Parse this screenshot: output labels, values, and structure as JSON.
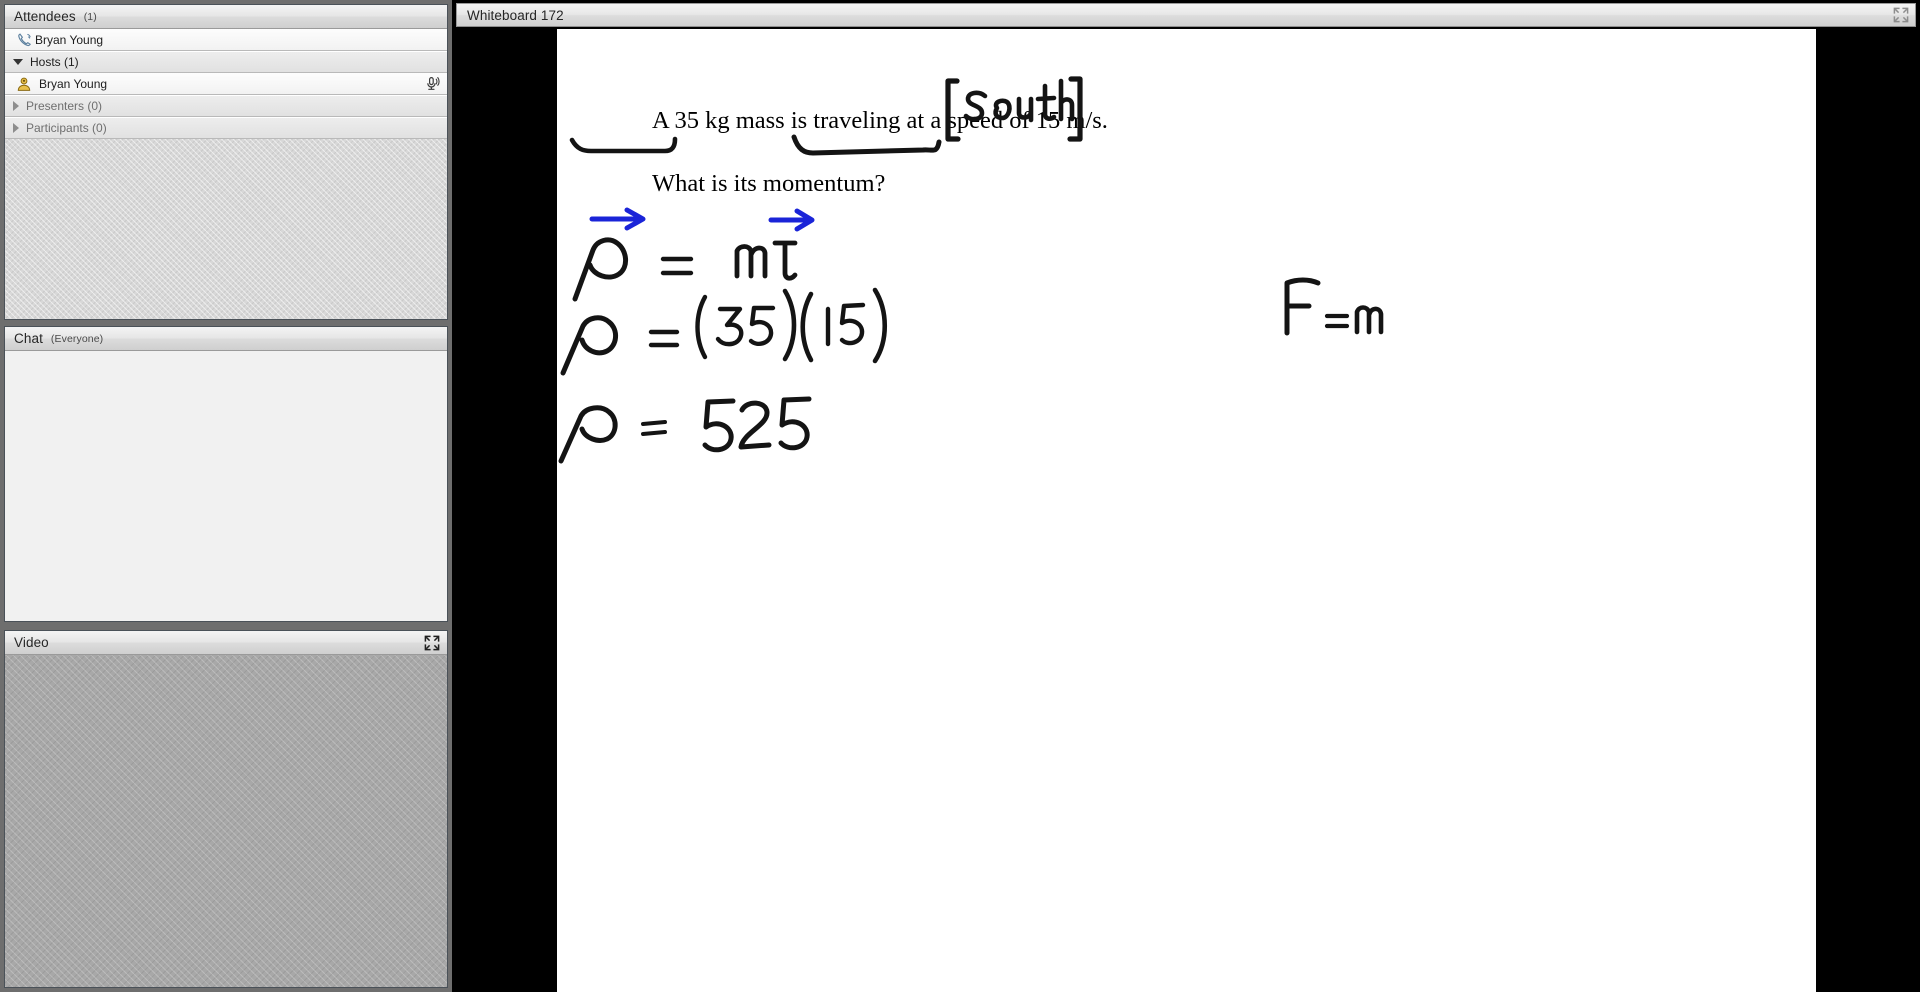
{
  "window": {
    "background_color": "#000000"
  },
  "attendees": {
    "title": "Attendees",
    "count_label": "(1)",
    "self_row": {
      "name": "Bryan Young",
      "icon": "phone-icon"
    },
    "groups": [
      {
        "label": "Hosts (1)",
        "expanded": true,
        "expander_icon": "triangle-down-icon",
        "members": [
          {
            "name": "Bryan Young",
            "avatar_icon": "user-avatar-icon",
            "status_icon": "microphone-icon"
          }
        ]
      },
      {
        "label": "Presenters (0)",
        "expanded": false,
        "expander_icon": "triangle-right-icon",
        "members": []
      },
      {
        "label": "Participants (0)",
        "expanded": false,
        "expander_icon": "triangle-right-icon",
        "members": []
      }
    ]
  },
  "chat": {
    "title": "Chat",
    "scope_label": "(Everyone)",
    "messages": []
  },
  "video": {
    "title": "Video",
    "expand_icon": "expand-arrows-icon"
  },
  "whiteboard": {
    "title": "Whiteboard 172",
    "expand_icon": "expand-arrows-icon",
    "question_line_1": "A 35 kg mass is traveling at a speed of 15 m/s.",
    "question_line_2": "What is its momentum?",
    "annotations": {
      "direction_note": "[South]",
      "direction_note_color": "#111111",
      "underline_1_target": "35 kg mass",
      "underline_2_target": "speed of 15 m/s",
      "vector_arrow_color": "#1a24d8",
      "ink_color": "#111111"
    },
    "work_lines": [
      {
        "left": "p",
        "left_has_vector_arrow": true,
        "relation": "=",
        "right": "m v",
        "right_has_vector_arrow": true
      },
      {
        "left": "p",
        "left_has_vector_arrow": false,
        "relation": "=",
        "right": "(35)(15)",
        "right_has_vector_arrow": false
      },
      {
        "left": "p",
        "left_has_vector_arrow": false,
        "relation": "=",
        "right": "525",
        "right_has_vector_arrow": false
      }
    ],
    "side_note": "F=m"
  }
}
